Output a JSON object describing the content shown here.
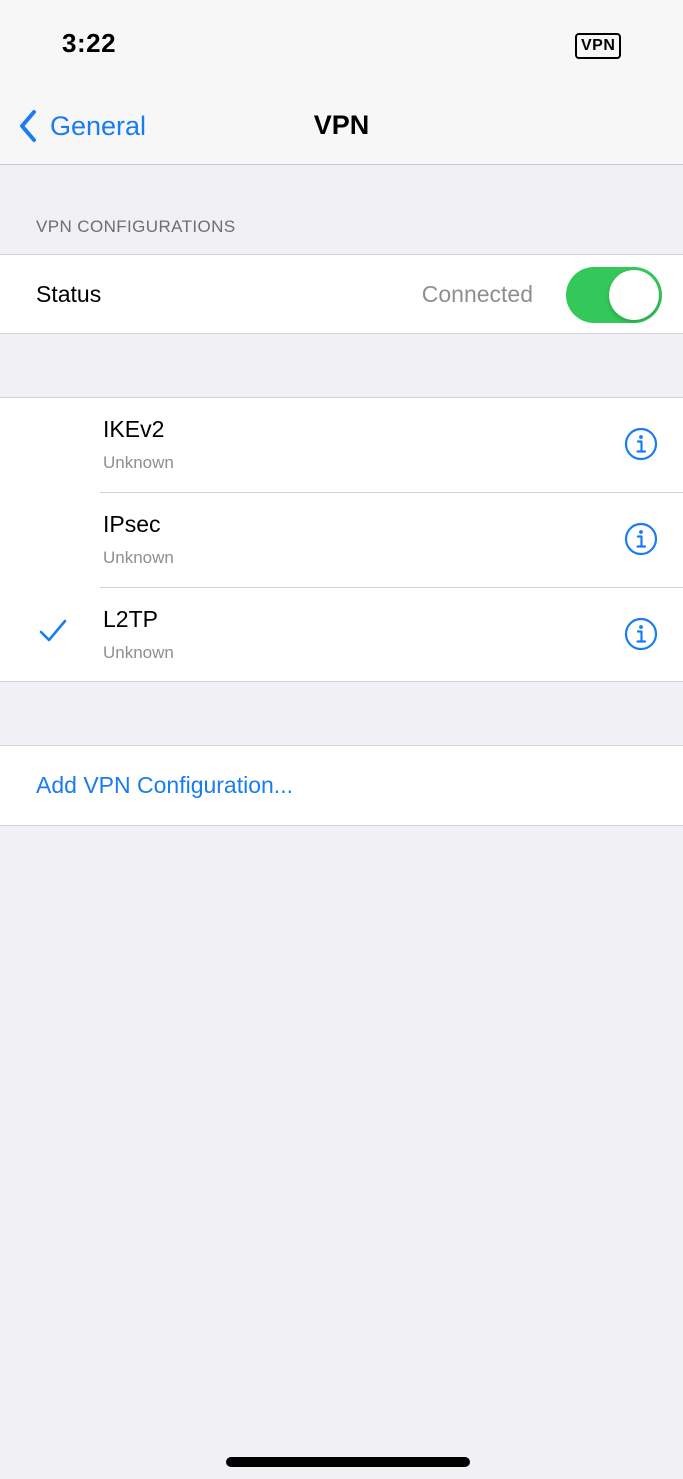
{
  "status_bar": {
    "time": "3:22",
    "vpn_badge": "VPN"
  },
  "nav": {
    "back_label": "General",
    "title": "VPN"
  },
  "section_header": "VPN CONFIGURATIONS",
  "status_row": {
    "label": "Status",
    "value": "Connected",
    "toggle_on": true
  },
  "configurations": [
    {
      "name": "IKEv2",
      "status": "Unknown",
      "selected": false
    },
    {
      "name": "IPsec",
      "status": "Unknown",
      "selected": false
    },
    {
      "name": "L2TP",
      "status": "Unknown",
      "selected": true
    }
  ],
  "add_configuration_label": "Add VPN Configuration...",
  "colors": {
    "accent": "#1a7cf2",
    "toggle_on": "#34c759",
    "background": "#f0f0f5"
  }
}
